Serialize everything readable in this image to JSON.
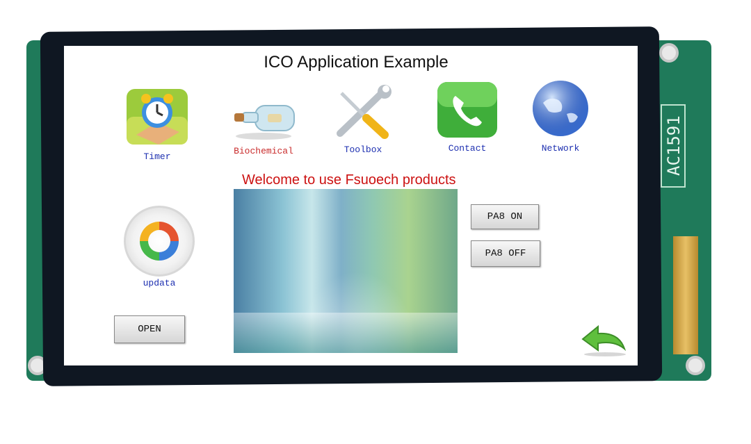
{
  "device": {
    "board_label": "AC1591",
    "pcb_color": "#1f7a5a",
    "bezel_color": "#0f1722"
  },
  "screen": {
    "title": "ICO Application Example",
    "welcome_text": "Welcome to use Fsuoech products"
  },
  "apps": [
    {
      "label": "Timer",
      "icon": "alarm-clock-icon"
    },
    {
      "label": "Biochemical",
      "icon": "bottle-icon"
    },
    {
      "label": "Toolbox",
      "icon": "wrench-screwdriver-icon"
    },
    {
      "label": "Contact",
      "icon": "phone-icon"
    },
    {
      "label": "Network",
      "icon": "globe-icon"
    },
    {
      "label": "updata",
      "icon": "refresh-arrows-icon"
    }
  ],
  "buttons": {
    "pa8_on": "PA8 ON",
    "pa8_off": "PA8 OFF",
    "open": "OPEN"
  },
  "icons": {
    "back": "back-arrow-icon"
  },
  "colors": {
    "title": "#111111",
    "welcome": "#cc1111",
    "app_label": "#1d2fb0",
    "app_label_alt": "#c92b2b"
  }
}
